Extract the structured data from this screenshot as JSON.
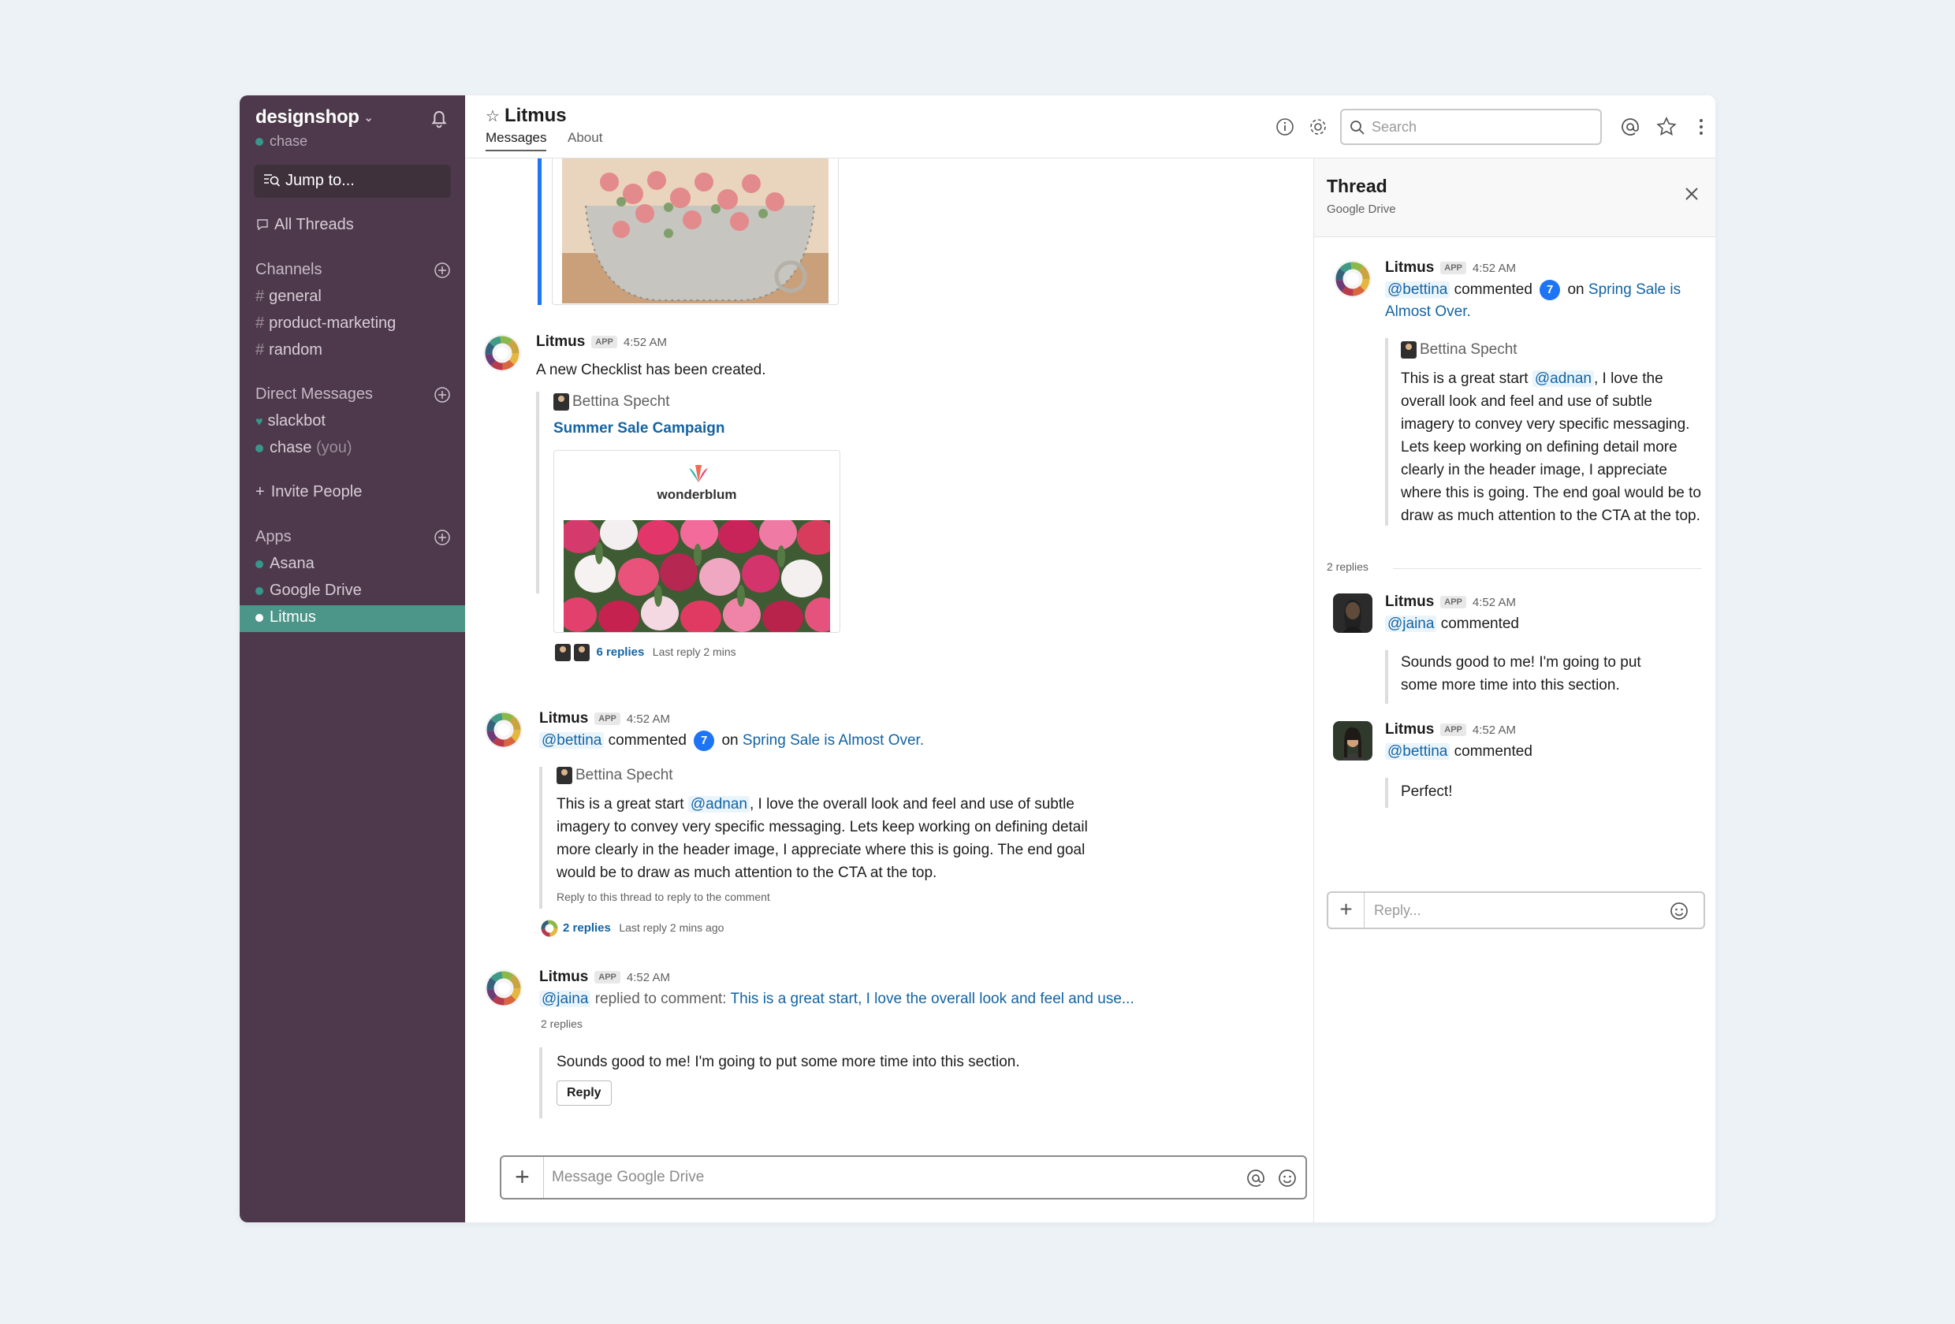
{
  "workspace": {
    "name": "designshop",
    "user": "chase"
  },
  "sidebar": {
    "jump_to": "Jump to...",
    "all_threads": "All Threads",
    "channels_label": "Channels",
    "channels": [
      "general",
      "product-marketing",
      "random"
    ],
    "dm_label": "Direct Messages",
    "dms": [
      {
        "name": "slackbot"
      },
      {
        "name": "chase",
        "suffix": "(you)"
      }
    ],
    "invite": "Invite People",
    "apps_label": "Apps",
    "apps": [
      "Asana",
      "Google Drive",
      "Litmus"
    ],
    "active_app": "Litmus"
  },
  "header": {
    "title": "Litmus",
    "tabs": [
      "Messages",
      "About"
    ],
    "search_placeholder": "Search"
  },
  "messages": {
    "m1": {
      "user": "Litmus",
      "badge": "APP",
      "time": "4:52 AM",
      "text": "A new Checklist has been created.",
      "attach_author": "Bettina Specht",
      "attach_title": "Summer Sale Campaign",
      "brand": "wonderblum",
      "replies": "6 replies",
      "last_reply": "Last reply 2 mins"
    },
    "m2": {
      "user": "Litmus",
      "badge": "APP",
      "time": "4:52 AM",
      "mention": "@bettina",
      "commented": "commented",
      "count": "7",
      "on": "on",
      "doc_link": "Spring Sale is Almost Over.",
      "quote_author": "Bettina Specht",
      "quote_pre": "This is a great start",
      "quote_mention": "@adnan",
      "quote_line1": ", I love the overall look and feel and use of subtle",
      "quote_line2": "imagery to convey very specific messaging. Lets keep working on defining detail",
      "quote_line3": "more clearly in the header image, I appreciate where this is going. The end goal",
      "quote_line4": "would be to draw as much attention to the CTA at the top.",
      "hint": "Reply to this thread to reply to the comment",
      "replies": "2 replies",
      "last_reply": "Last reply 2 mins ago"
    },
    "m3": {
      "user": "Litmus",
      "badge": "APP",
      "time": "4:52 AM",
      "mention": "@jaina",
      "replied": "replied to comment:",
      "link": "This is a great start, I love the overall look and feel and use...",
      "replies": "2 replies",
      "quote": "Sounds good to me! I'm going to put some more time into this section.",
      "reply_button": "Reply"
    },
    "composer_placeholder": "Message Google Drive"
  },
  "thread": {
    "title": "Thread",
    "subtitle": "Google Drive",
    "root": {
      "user": "Litmus",
      "badge": "APP",
      "time": "4:52 AM",
      "mention": "@bettina",
      "commented": "commented",
      "count": "7",
      "on": "on",
      "link_line1": "Spring Sale is",
      "link_line2": "Almost Over.",
      "quote_author": "Bettina Specht",
      "q_pre": "This is a great start",
      "q_mention": "@adnan",
      "q_post": ", I love the",
      "q2": "overall look and feel and use of subtle",
      "q3": "imagery to convey very specific messaging.",
      "q4": "Lets keep working on defining detail more",
      "q5": "clearly in the header image, I appreciate",
      "q6": "where this is going. The end goal would be to",
      "q7": "draw as much attention to the CTA at the top."
    },
    "reply_count": "2 replies",
    "replies": [
      {
        "user": "Litmus",
        "badge": "APP",
        "time": "4:52 AM",
        "mention": "@jaina",
        "action": "commented",
        "text1": "Sounds good to me! I'm going to put",
        "text2": "some more time into this section."
      },
      {
        "user": "Litmus",
        "badge": "APP",
        "time": "4:52 AM",
        "mention": "@bettina",
        "action": "commented",
        "text1": "Perfect!"
      }
    ],
    "reply_placeholder": "Reply..."
  },
  "colors": {
    "sidebar": "#4d394b",
    "active": "#4c9689",
    "link": "#1264a3",
    "badge": "#1d74f5"
  }
}
